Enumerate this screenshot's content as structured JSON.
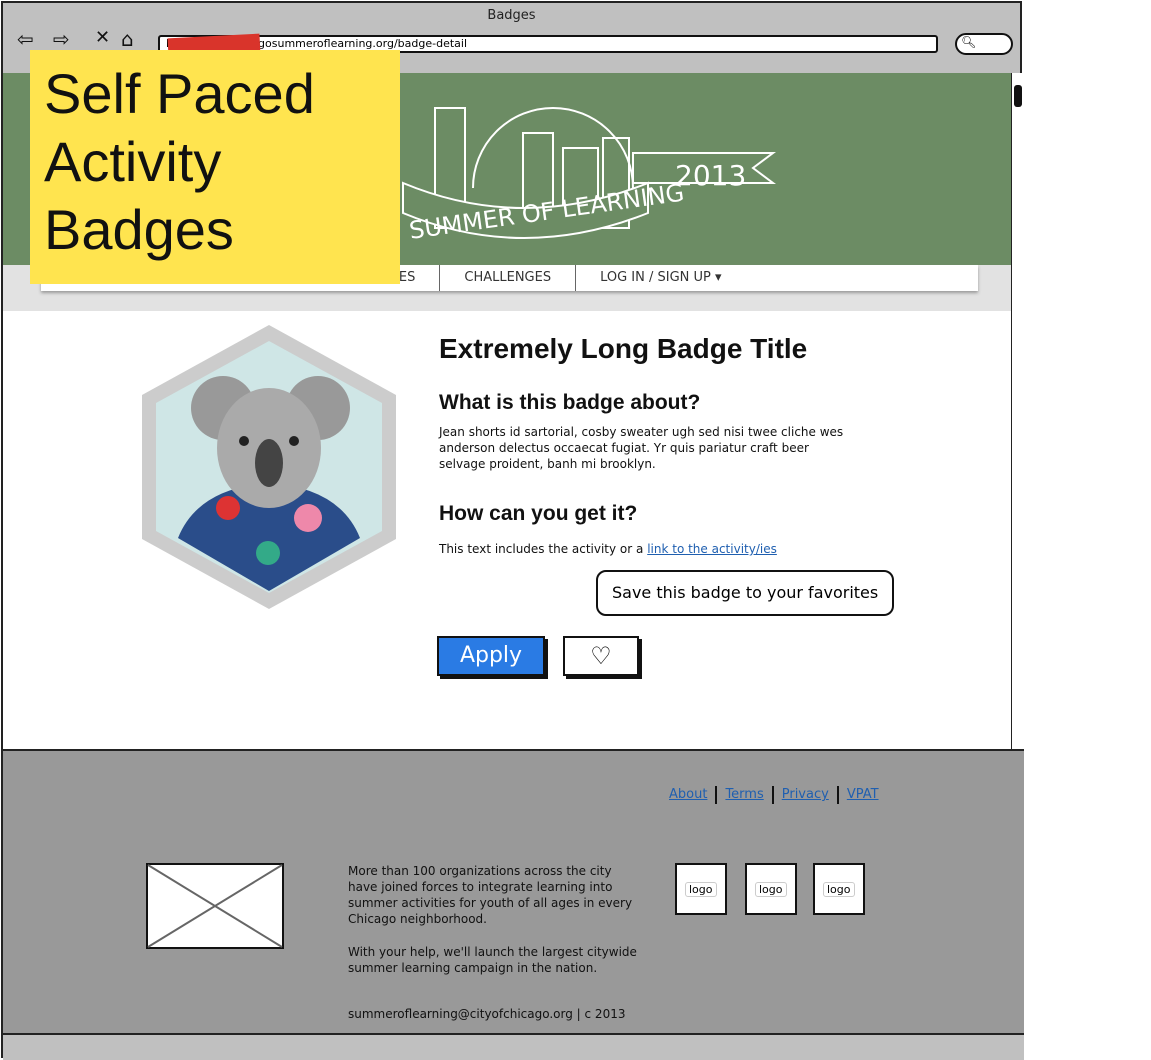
{
  "browser": {
    "title": "Badges",
    "url": "http://www.chicagosummeroflearning.org/badge-detail"
  },
  "banner": {
    "text": "SUMMER OF LEARNING",
    "year": "2013"
  },
  "nav": {
    "items": [
      "BADGES",
      "CHALLENGES",
      "LOG IN / SIGN UP ▾"
    ]
  },
  "sticky": {
    "text": "Self Paced Activity Badges"
  },
  "badge": {
    "title": "Extremely Long Badge Title",
    "about_heading": "What is this badge about?",
    "about_text": "Jean shorts id sartorial, cosby sweater ugh sed nisi twee cliche wes anderson delectus occaecat fugiat. Yr quis pariatur craft beer selvage proident, banh mi brooklyn.",
    "how_heading": "How can you get it?",
    "how_text": "This text includes the activity or a ",
    "how_link": "link to the activity/ies",
    "tooltip": "Save this badge to your favorites",
    "apply_label": "Apply",
    "favorite_icon": "♡"
  },
  "footer": {
    "links": [
      "About",
      "Terms",
      "Privacy",
      "VPAT"
    ],
    "text1": "More than 100 organizations across the city have joined forces to integrate learning into summer activities for youth of all ages in every Chicago neighborhood.",
    "text2": "With your help, we'll launch the largest citywide summer learning campaign in the nation.",
    "contact": "summeroflearning@cityofchicago.org | c 2013",
    "logos": [
      "logo",
      "logo",
      "logo"
    ]
  }
}
